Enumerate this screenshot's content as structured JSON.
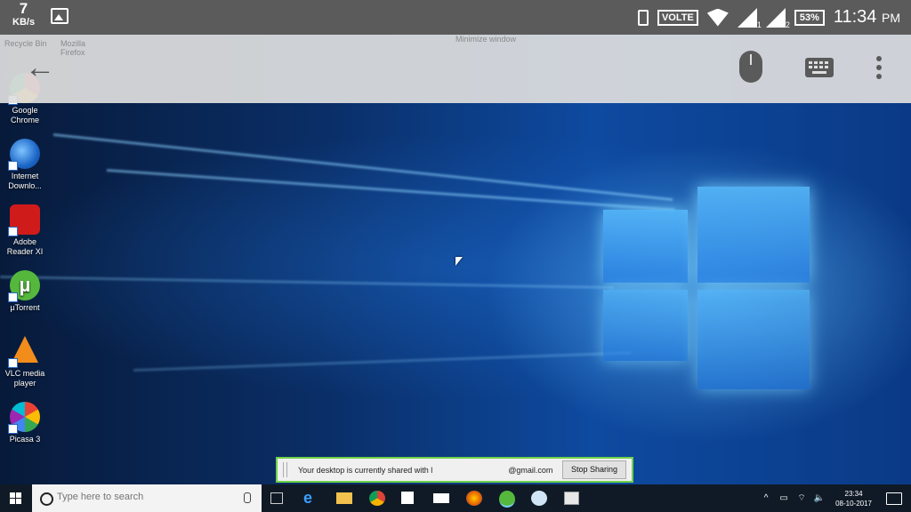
{
  "status_bar": {
    "speed_value": "7",
    "speed_unit": "KB/s",
    "network_label": "VOLTE",
    "sim1": "1",
    "sim2": "2",
    "battery": "53%",
    "time": "11:34",
    "time_suffix": "PM",
    "icons": [
      "gallery-icon",
      "vibrate-icon",
      "wifi-icon",
      "signal-icon",
      "battery-icon"
    ]
  },
  "toolbar": {
    "icons": [
      "back-arrow-icon",
      "mouse-icon",
      "keyboard-icon",
      "more-vert-icon"
    ],
    "ghost_icons": [
      {
        "label": "Recycle Bin"
      },
      {
        "label": "Mozilla Firefox"
      }
    ],
    "tooltip": "Minimize window"
  },
  "desktop_icons": [
    {
      "label": "Google Chrome",
      "icon": "chrome-icon"
    },
    {
      "label": "Internet Downlo...",
      "icon": "idm-icon"
    },
    {
      "label": "Adobe Reader XI",
      "icon": "adobe-reader-icon"
    },
    {
      "label": "µTorrent",
      "icon": "utorrent-icon"
    },
    {
      "label": "VLC media player",
      "icon": "vlc-icon"
    },
    {
      "label": "Picasa 3",
      "icon": "picasa-icon"
    }
  ],
  "share_bar": {
    "text_prefix": "Your desktop is currently shared with l",
    "text_suffix": "@gmail.com",
    "button": "Stop Sharing"
  },
  "taskbar": {
    "search_placeholder": "Type here to search",
    "pinned": [
      "task-view-icon",
      "edge-icon",
      "file-explorer-icon",
      "chrome-icon",
      "store-icon",
      "mail-icon",
      "firefox-icon",
      "utorrent-icon",
      "teamviewer-icon",
      "app-icon"
    ],
    "tray_time": "23:34",
    "tray_date": "08-10-2017",
    "accent": "#0078d7"
  }
}
